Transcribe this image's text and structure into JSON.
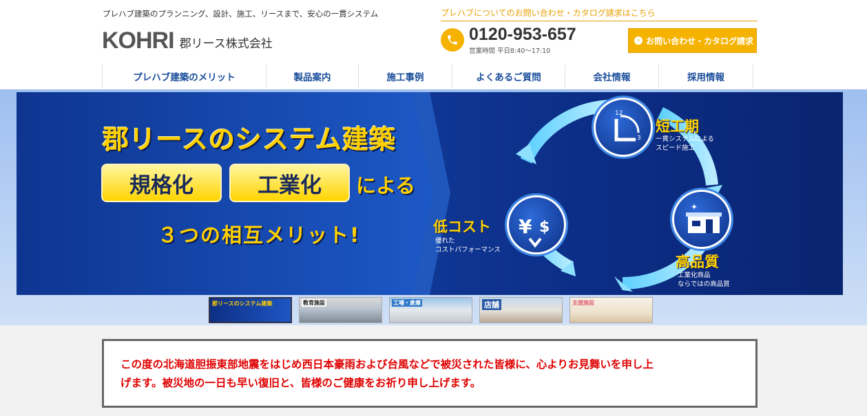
{
  "header": {
    "tagline": "プレハブ建築のプランニング、設計、施工、リースまで、安心の一貫システム",
    "logo_text": "KOHRI",
    "company_name": "郡リース株式会社",
    "contact_heading": "プレハブについてのお問い合わせ・カタログ請求はこちら",
    "phone_number": "0120-953-657",
    "business_hours": "営業時間 平日8:40〜17:10",
    "contact_button": "お問い合わせ・カタログ請求",
    "accent_color": "#f5b300",
    "nav_color": "#1b4e9b"
  },
  "nav": {
    "items": [
      {
        "label": "プレハブ建築のメリット"
      },
      {
        "label": "製品案内"
      },
      {
        "label": "施工事例"
      },
      {
        "label": "よくあるご質問"
      },
      {
        "label": "会社情報"
      },
      {
        "label": "採用情報"
      }
    ]
  },
  "hero": {
    "title": "郡リースのシステム建築",
    "pill_1": "規格化",
    "pill_2": "工業化",
    "niyoru": "による",
    "mutual": "３つの相互メリット!",
    "short_term": {
      "title": "短工期",
      "desc_1": "一貫システムによる",
      "desc_2": "スピード施工",
      "icon": "clock-icon"
    },
    "low_cost": {
      "title": "低コスト",
      "desc_1": "優れた",
      "desc_2": "コストパフォーマンス",
      "icon": "yen-dollar-icon"
    },
    "quality": {
      "title": "高品質",
      "desc_1": "工業化商品",
      "desc_2": "ならではの高品質",
      "icon": "building-icon"
    }
  },
  "thumbnails": [
    {
      "label": "郡リースのシステム建築",
      "active": true
    },
    {
      "label": "教育施設",
      "active": false
    },
    {
      "label": "工場・倉庫",
      "active": false
    },
    {
      "label": "店舗",
      "active": false
    },
    {
      "label": "支援施設",
      "active": false
    }
  ],
  "notice": {
    "text_line_1": "この度の北海道胆振東部地震をはじめ西日本豪雨および台風などで被災された皆様に、心よりお見舞いを申し上",
    "text_line_2": "げます。被災地の一日も早い復旧と、皆様のご健康をお祈り申し上げます。",
    "color": "#e00000"
  }
}
